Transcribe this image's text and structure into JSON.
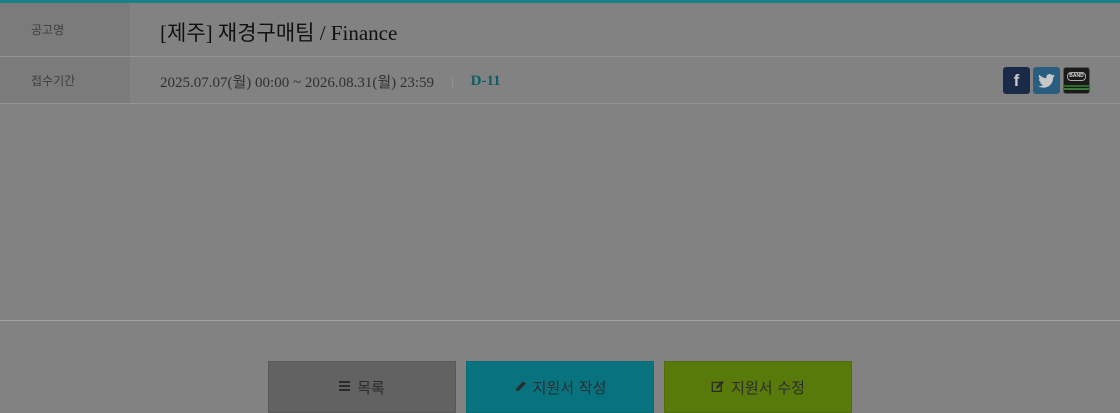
{
  "notice": {
    "title_label": "공고명",
    "title": "[제주] 재경구매팀 / Finance",
    "period_label": "접수기간",
    "period": "2025.07.07(월) 00:00 ~ 2026.08.31(월) 23:59",
    "separator": "|",
    "dday": "D-11"
  },
  "share": {
    "facebook_glyph": "f",
    "band_text": "BAND"
  },
  "buttons": {
    "list_label": "목록",
    "write_label": "지원서 작성",
    "edit_label": "지원서 수정"
  },
  "colors": {
    "accent": "#1a7f86",
    "list_button": "#626262",
    "write_button": "#08737f",
    "edit_button": "#587a0b"
  },
  "icons": [
    "facebook-icon",
    "twitter-icon",
    "band-icon",
    "list-icon",
    "pencil-icon",
    "edit-icon"
  ]
}
